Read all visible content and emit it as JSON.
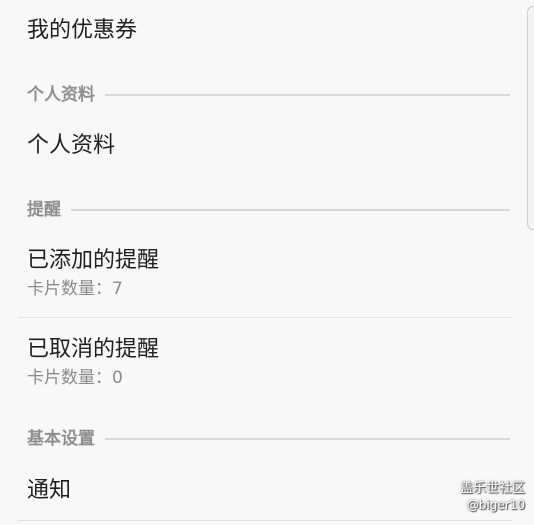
{
  "items": {
    "coupons": {
      "title": "我的优惠券"
    },
    "profile": {
      "title": "个人资料"
    },
    "added_reminders": {
      "title": "已添加的提醒",
      "subtitle": "卡片数量：7"
    },
    "cancelled_reminders": {
      "title": "已取消的提醒",
      "subtitle": "卡片数量：0"
    },
    "notifications": {
      "title": "通知"
    }
  },
  "sections": {
    "profile": "个人资料",
    "reminders": "提醒",
    "basic_settings": "基本设置"
  },
  "watermark": {
    "title": "盖乐世社区",
    "user": "@biger10"
  }
}
